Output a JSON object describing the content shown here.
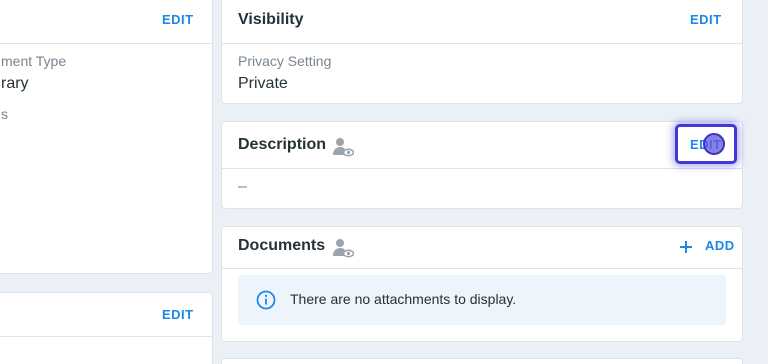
{
  "left_top_card": {
    "edit_label": "EDIT",
    "field1_label": "ment Type",
    "field1_value": "rary",
    "field2_label": "s"
  },
  "left_bottom_card": {
    "edit_label": "EDIT"
  },
  "visibility_card": {
    "title": "Visibility",
    "edit_label": "EDIT",
    "privacy_label": "Privacy Setting",
    "privacy_value": "Private"
  },
  "description_card": {
    "title": "Description",
    "edit_label": "EDIT",
    "value": "–",
    "icon": "person-eye-icon"
  },
  "documents_card": {
    "title": "Documents",
    "add_label": "ADD",
    "icon": "person-eye-icon",
    "empty_message": "There are no attachments to display."
  },
  "colors": {
    "accent": "#1e88e5",
    "focus": "#4338d6",
    "background": "#eaf0f6"
  }
}
